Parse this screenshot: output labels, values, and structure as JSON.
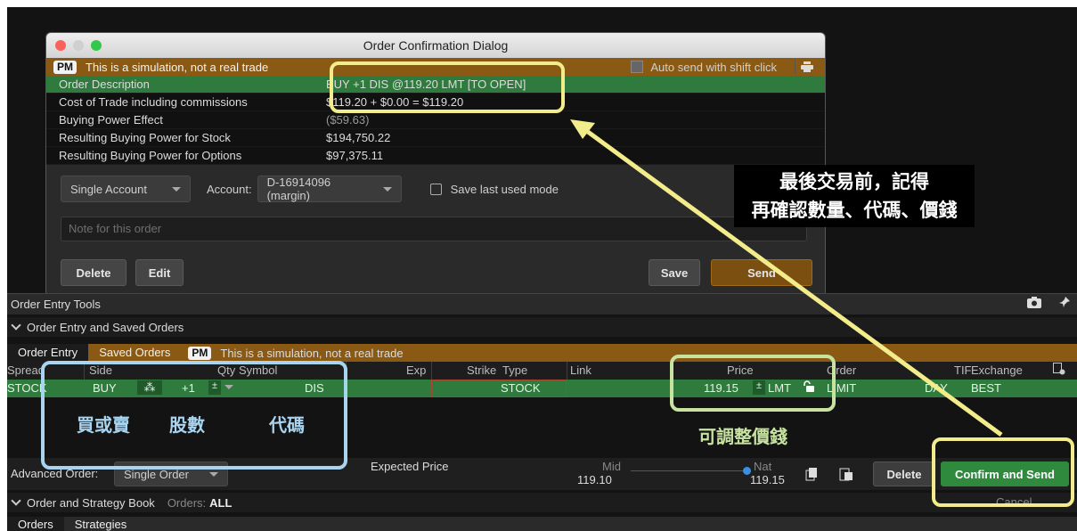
{
  "dialog": {
    "title": "Order Confirmation Dialog",
    "pm_badge": "PM",
    "sim_notice": "This is a simulation, not a real trade",
    "auto_send_label": "Auto send with shift click",
    "rows": [
      {
        "label": "Order Description",
        "value": "BUY +1 DIS @119.20 LMT [TO OPEN]"
      },
      {
        "label": "Cost of Trade including commissions",
        "value": "$119.20 + $0.00 = $119.20"
      },
      {
        "label": "Buying Power Effect",
        "value": "($59.63)"
      },
      {
        "label": "Resulting Buying Power for Stock",
        "value": "$194,750.22"
      },
      {
        "label": "Resulting Buying Power for Options",
        "value": "$97,375.11"
      }
    ],
    "account_mode": "Single Account",
    "account_label": "Account:",
    "account_value": "D-16914096 (margin)",
    "save_mode_label": "Save last used mode",
    "note_placeholder": "Note for this order",
    "delete_label": "Delete",
    "edit_label": "Edit",
    "save_label": "Save",
    "send_label": "Send"
  },
  "tools": {
    "title": "Order Entry Tools",
    "section": "Order Entry and Saved Orders",
    "tabs": [
      "Order Entry",
      "Saved Orders"
    ],
    "pm_badge": "PM",
    "sim_notice": "This is a simulation, not a real trade"
  },
  "grid": {
    "headers": {
      "spread": "Spread",
      "side": "Side",
      "qty": "Qty",
      "symbol": "Symbol",
      "exp": "Exp",
      "strike": "Strike",
      "type": "Type",
      "link": "Link",
      "price": "Price",
      "order": "Order",
      "tif": "TIF",
      "exchange": "Exchange"
    },
    "row": {
      "spread": "STOCK",
      "side": "BUY",
      "qty": "+1",
      "symbol": "DIS",
      "type": "STOCK",
      "price": "119.15",
      "price_type": "LMT",
      "order": "LIMIT",
      "tif": "DAY",
      "exchange": "BEST"
    }
  },
  "advanced": {
    "label": "Advanced Order:",
    "value": "Single Order",
    "expected_price_label": "Expected Price",
    "mid_label": "Mid",
    "mid_value": "119.10",
    "nat_label": "Nat",
    "nat_value": "119.15",
    "delete_label": "Delete",
    "confirm_label": "Confirm and Send"
  },
  "book": {
    "title": "Order and Strategy Book",
    "orders_label": "Orders:",
    "orders_value": "ALL",
    "cancel_label": "Cancel"
  },
  "bottom_tabs": [
    "Orders",
    "Strategies"
  ],
  "annotations": {
    "callout_line1": "最後交易前，記得",
    "callout_line2": "再確認數量、代碼、價錢",
    "side_label": "買或賣",
    "qty_label": "股數",
    "symbol_label": "代碼",
    "price_label": "可調整價錢"
  },
  "colors": {
    "sim_bar": "#8a5a14",
    "selected_row": "#2f7b3d",
    "annotation_yellow": "#f3ec8b",
    "annotation_blue": "#a8d4f0",
    "annotation_green": "#c8e3a0"
  }
}
